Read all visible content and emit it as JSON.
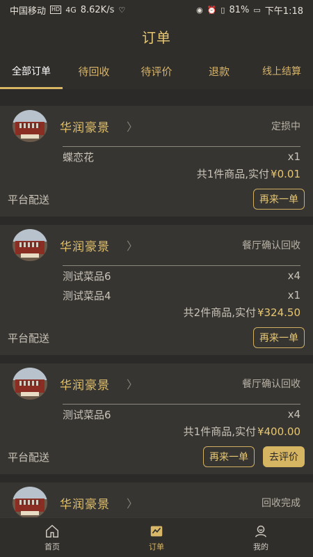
{
  "status_bar": {
    "carrier": "中国移动",
    "network": "HD",
    "signal": "4G",
    "speed": "8.62K/s",
    "battery": "81%",
    "time": "下午1:18"
  },
  "page_title": "订单",
  "tabs": [
    {
      "label": "全部订单",
      "active": true
    },
    {
      "label": "待回收",
      "active": false
    },
    {
      "label": "待评价",
      "active": false
    },
    {
      "label": "退款",
      "active": false
    },
    {
      "label": "线上结算",
      "active": false
    }
  ],
  "orders": [
    {
      "store": "华润豪景",
      "status": "定损中",
      "items": [
        {
          "name": "蝶恋花",
          "qty": "x1"
        }
      ],
      "summary_prefix": "共1件商品,实付",
      "price": "¥0.01",
      "delivery": "平台配送",
      "buttons": [
        "再来一单"
      ]
    },
    {
      "store": "华润豪景",
      "status": "餐厅确认回收",
      "items": [
        {
          "name": "测试菜品6",
          "qty": "x4"
        },
        {
          "name": "测试菜品4",
          "qty": "x1"
        }
      ],
      "summary_prefix": "共2件商品,实付",
      "price": "¥324.50",
      "delivery": "平台配送",
      "buttons": [
        "再来一单"
      ]
    },
    {
      "store": "华润豪景",
      "status": "餐厅确认回收",
      "items": [
        {
          "name": "测试菜品6",
          "qty": "x4"
        }
      ],
      "summary_prefix": "共1件商品,实付",
      "price": "¥400.00",
      "delivery": "平台配送",
      "buttons": [
        "再来一单",
        "去评价"
      ]
    },
    {
      "store": "华润豪景",
      "status": "回收完成"
    }
  ],
  "bottom_nav": [
    {
      "label": "首页",
      "icon": "home-icon",
      "active": false
    },
    {
      "label": "订单",
      "icon": "orders-icon",
      "active": true
    },
    {
      "label": "我的",
      "icon": "profile-icon",
      "active": false
    }
  ],
  "colors": {
    "accent": "#e7c773",
    "background": "#2b2a28",
    "card": "#363531"
  }
}
